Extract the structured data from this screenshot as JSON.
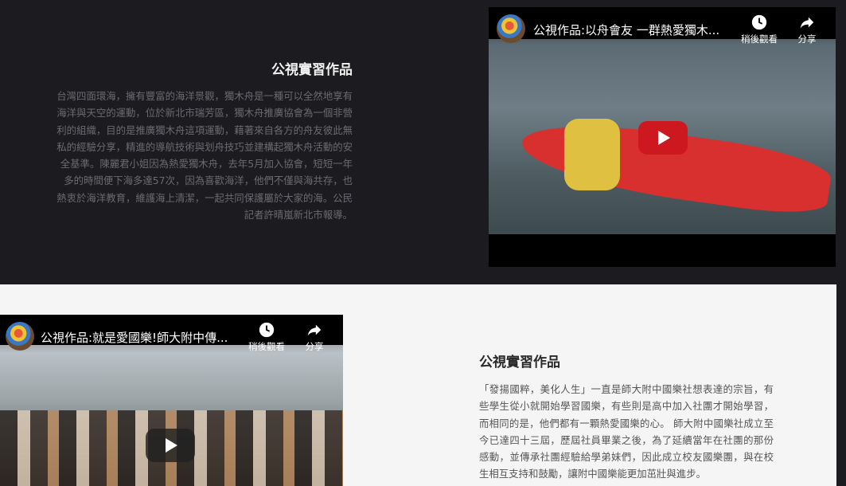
{
  "section1": {
    "title": "公視實習作品",
    "body": "台灣四面環海，擁有豐富的海洋景觀，獨木舟是一種可以全然地享有海洋與天空的運動，位於新北市瑞芳區，獨木舟推廣協會為一個非營利的組織，目的是推廣獨木舟這項運動，藉著來自各方的舟友彼此無私的經驗分享，精進的導航技術與划舟技巧並建構起獨木舟活動的安全基準。陳麗君小姐因為熱愛獨木舟，去年5月加入協會，短短一年多的時間便下海多達57次，因為喜歡海洋，他們不僅與海共存，也熱衷於海洋教育，維護海上清潔，一起共同保護屬於大家的海。公民記者許晴嵐新北市報導。",
    "video": {
      "title": "公視作品:以舟會友 一群熱愛獨木...",
      "watch_later": "稍後觀看",
      "share": "分享"
    }
  },
  "section2": {
    "title": "公視實習作品",
    "body": "「發揚國粹，美化人生」一直是師大附中國樂社想表達的宗旨，有些學生從小就開始學習國樂，有些則是高中加入社團才開始學習，而相同的是，他們都有一顆熱愛國樂的心。 師大附中國樂社成立至今已達四十三屆，歷屆社員畢業之後，為了延續當年在社團的那份感動，並傳承社團經驗給學弟妹們，因此成立校友國樂團，與在校生相互支持和鼓勵，讓附中國樂能更加茁壯與進步。",
    "video": {
      "title": "公視作品:就是愛國樂!師大附中傳...",
      "watch_later": "稍後觀看",
      "share": "分享"
    }
  },
  "colors": {
    "dark_bg": "#1c1c20",
    "light_bg": "#f5f5f5",
    "play_red": "#cc181e"
  }
}
